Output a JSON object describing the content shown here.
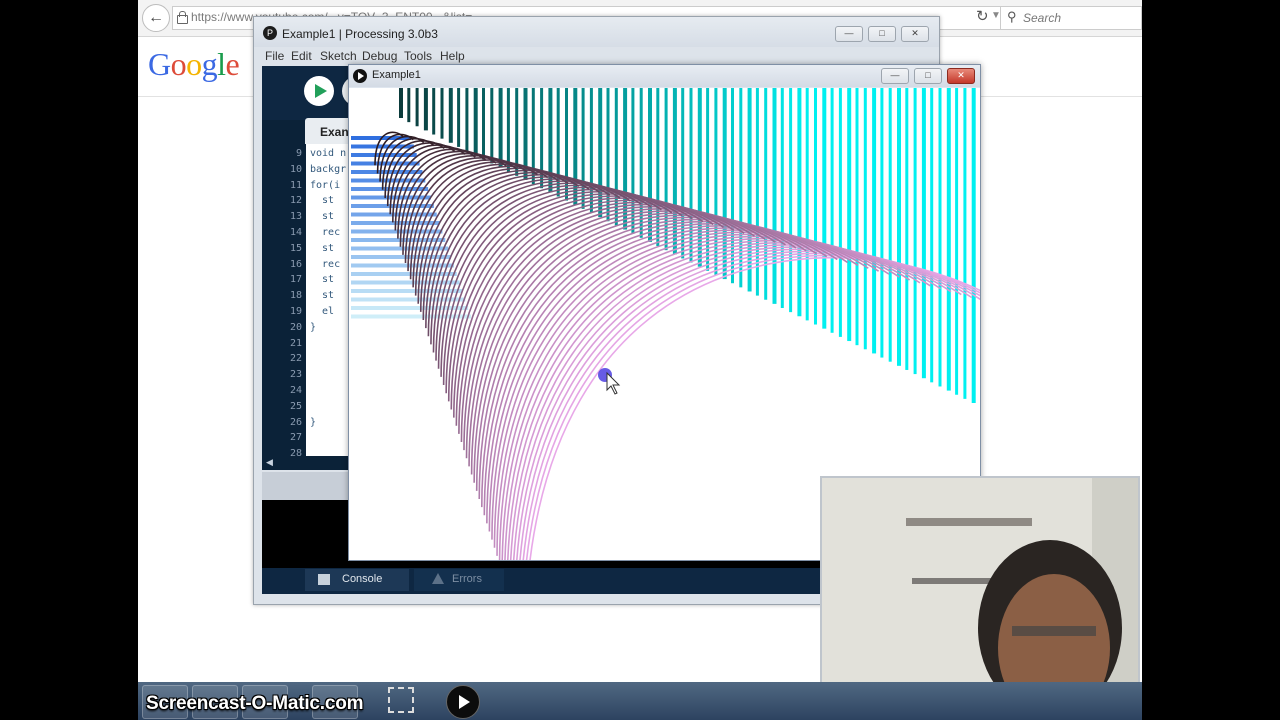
{
  "browser": {
    "url": "https://www.youtube.com/...v=TOV_3_ENT00...&list=...",
    "search_placeholder": "Search",
    "logo": {
      "letters": [
        {
          "ch": "G",
          "color": "#3b69e3"
        },
        {
          "ch": "o",
          "color": "#dd4b39"
        },
        {
          "ch": "o",
          "color": "#f4b400"
        },
        {
          "ch": "g",
          "color": "#3b69e3"
        },
        {
          "ch": "l",
          "color": "#1a9c4c"
        },
        {
          "ch": "e",
          "color": "#dd4b39"
        }
      ]
    }
  },
  "pde": {
    "title": "Example1 | Processing 3.0b3",
    "menu": [
      "File",
      "Edit",
      "Sketch",
      "Debug",
      "Tools",
      "Help"
    ],
    "tab_label": "Exan",
    "line_numbers": [
      "9",
      "10",
      "11",
      "12",
      "13",
      "14",
      "15",
      "16",
      "17",
      "18",
      "19",
      "20",
      "21",
      "22",
      "23",
      "24",
      "25",
      "26",
      "27",
      "28"
    ],
    "code_lines": [
      "void n",
      "backgr",
      "for(i",
      "  st",
      "  st",
      "  rec",
      "  st",
      "  rec",
      "  st",
      "  st",
      "  el",
      "}",
      "",
      "",
      "",
      "",
      "",
      "}",
      "",
      ""
    ],
    "console_tab": "Console",
    "errors_tab": "Errors"
  },
  "sketch": {
    "title": "Example1",
    "colors": {
      "bars_dark": "#0b3b3b",
      "bars_light": "#00f0f0",
      "arc_dark": "#2b1a20",
      "arc_light": "#e8a8e8",
      "left_bars_dark": "#2f6fe0",
      "left_bars_light": "#cfeef8"
    }
  },
  "taskbar": {
    "brand": "Screencast-O-Matic.com"
  }
}
